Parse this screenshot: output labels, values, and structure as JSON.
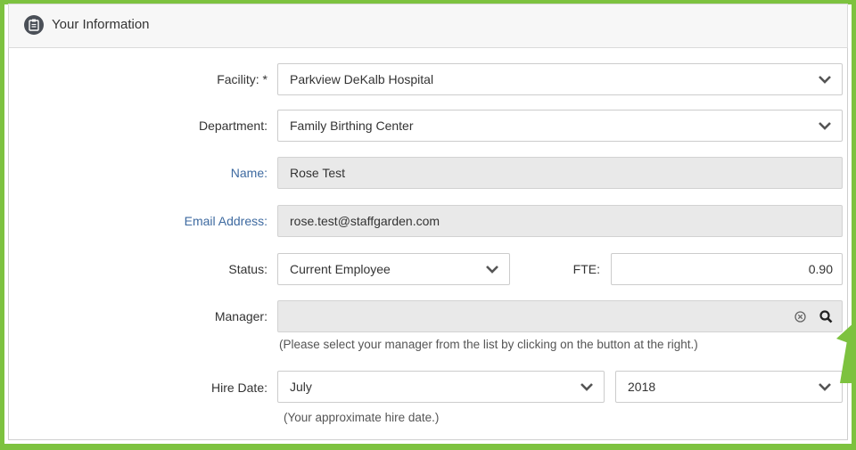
{
  "panel": {
    "title": "Your Information",
    "icon": "clipboard-icon"
  },
  "form": {
    "facility": {
      "label": "Facility: *",
      "value": "Parkview DeKalb Hospital"
    },
    "department": {
      "label": "Department:",
      "value": "Family Birthing Center"
    },
    "name": {
      "label": "Name:",
      "value": "Rose Test"
    },
    "email": {
      "label": "Email Address:",
      "value": "rose.test@staffgarden.com"
    },
    "status": {
      "label": "Status:",
      "value": "Current Employee"
    },
    "fte": {
      "label": "FTE:",
      "value": "0.90"
    },
    "manager": {
      "label": "Manager:",
      "value": "",
      "help": "(Please select your manager from the list by clicking on the button at the right.)"
    },
    "hire_date": {
      "label": "Hire Date:",
      "month": "July",
      "year": "2018",
      "help": "(Your approximate hire date.)"
    }
  },
  "colors": {
    "frame_border": "#7dc23f",
    "link_label": "#3e6aa0",
    "readonly_bg": "#e9e9e9"
  }
}
